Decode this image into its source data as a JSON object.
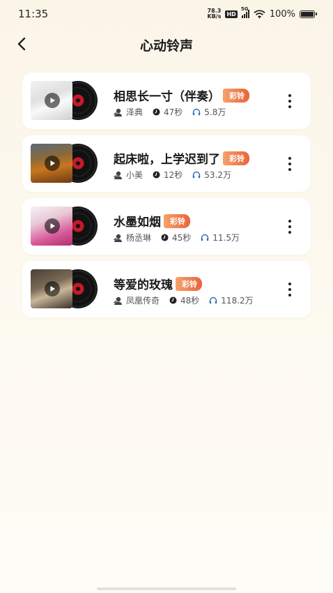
{
  "status_bar": {
    "time": "11:35",
    "net_speed_value": "78.3",
    "net_speed_unit": "KB/s",
    "hd": "HD",
    "network": "5G",
    "battery": "100%"
  },
  "header": {
    "title": "心动铃声"
  },
  "badge_label": "彩铃",
  "ringtones": [
    {
      "title": "相思长一寸（伴奏）",
      "artist": "泽典",
      "duration": "47秒",
      "plays": "5.8万"
    },
    {
      "title": "起床啦，上学迟到了",
      "artist": "小美",
      "duration": "12秒",
      "plays": "53.2万"
    },
    {
      "title": "水墨如烟",
      "artist": "杨丞琳",
      "duration": "45秒",
      "plays": "11.5万"
    },
    {
      "title": "等爱的玫瑰",
      "artist": "凤凰传奇",
      "duration": "48秒",
      "plays": "118.2万"
    }
  ],
  "colors": {
    "badge": "#e8663c",
    "vinyl_center": "#c41a28",
    "plays_icon": "#2f6fb5"
  }
}
